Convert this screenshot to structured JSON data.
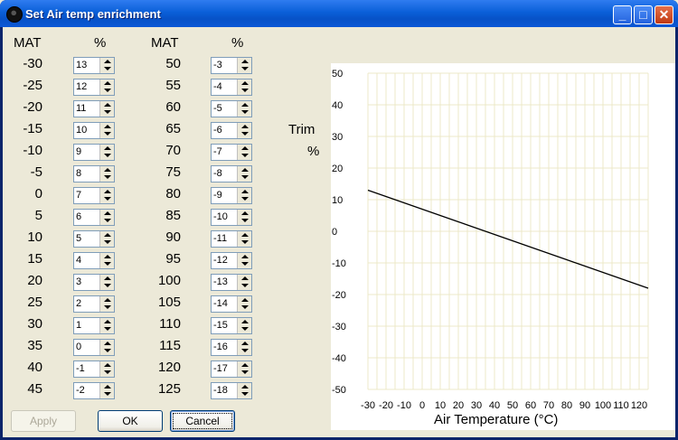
{
  "window": {
    "title": "Set Air temp enrichment"
  },
  "table": {
    "left": {
      "mat_header": "MAT",
      "pct_header": "%",
      "rows": [
        {
          "mat": "-30",
          "pct": "13"
        },
        {
          "mat": "-25",
          "pct": "12"
        },
        {
          "mat": "-20",
          "pct": "11"
        },
        {
          "mat": "-15",
          "pct": "10"
        },
        {
          "mat": "-10",
          "pct": "9"
        },
        {
          "mat": "-5",
          "pct": "8"
        },
        {
          "mat": "0",
          "pct": "7"
        },
        {
          "mat": "5",
          "pct": "6"
        },
        {
          "mat": "10",
          "pct": "5"
        },
        {
          "mat": "15",
          "pct": "4"
        },
        {
          "mat": "20",
          "pct": "3"
        },
        {
          "mat": "25",
          "pct": "2"
        },
        {
          "mat": "30",
          "pct": "1"
        },
        {
          "mat": "35",
          "pct": "0"
        },
        {
          "mat": "40",
          "pct": "-1"
        },
        {
          "mat": "45",
          "pct": "-2"
        }
      ]
    },
    "right": {
      "mat_header": "MAT",
      "pct_header": "%",
      "rows": [
        {
          "mat": "50",
          "pct": "-3"
        },
        {
          "mat": "55",
          "pct": "-4"
        },
        {
          "mat": "60",
          "pct": "-5"
        },
        {
          "mat": "65",
          "pct": "-6"
        },
        {
          "mat": "70",
          "pct": "-7"
        },
        {
          "mat": "75",
          "pct": "-8"
        },
        {
          "mat": "80",
          "pct": "-9"
        },
        {
          "mat": "85",
          "pct": "-10"
        },
        {
          "mat": "90",
          "pct": "-11"
        },
        {
          "mat": "95",
          "pct": "-12"
        },
        {
          "mat": "100",
          "pct": "-13"
        },
        {
          "mat": "105",
          "pct": "-14"
        },
        {
          "mat": "110",
          "pct": "-15"
        },
        {
          "mat": "115",
          "pct": "-16"
        },
        {
          "mat": "120",
          "pct": "-17"
        },
        {
          "mat": "125",
          "pct": "-18"
        }
      ]
    }
  },
  "trim_label": {
    "line1": "Trim",
    "line2": "%"
  },
  "buttons": {
    "apply": "Apply",
    "ok": "OK",
    "cancel": "Cancel"
  },
  "chart_data": {
    "type": "line",
    "xlabel": "Air Temperature (°C)",
    "ylabel": "Trim %",
    "xlim": [
      -30,
      125
    ],
    "ylim": [
      -50,
      50
    ],
    "x_ticks": [
      -30,
      -20,
      -10,
      0,
      10,
      20,
      30,
      40,
      50,
      60,
      70,
      80,
      90,
      100,
      110,
      120
    ],
    "y_ticks": [
      50,
      40,
      30,
      20,
      10,
      0,
      -10,
      -20,
      -30,
      -40,
      -50
    ],
    "grid": true,
    "x": [
      -30,
      -25,
      -20,
      -15,
      -10,
      -5,
      0,
      5,
      10,
      15,
      20,
      25,
      30,
      35,
      40,
      45,
      50,
      55,
      60,
      65,
      70,
      75,
      80,
      85,
      90,
      95,
      100,
      105,
      110,
      115,
      120,
      125
    ],
    "y": [
      13,
      12,
      11,
      10,
      9,
      8,
      7,
      6,
      5,
      4,
      3,
      2,
      1,
      0,
      -1,
      -2,
      -3,
      -4,
      -5,
      -6,
      -7,
      -8,
      -9,
      -10,
      -11,
      -12,
      -13,
      -14,
      -15,
      -16,
      -17,
      -18
    ],
    "line_color": "#000000",
    "grid_color": "#ece9c8"
  }
}
